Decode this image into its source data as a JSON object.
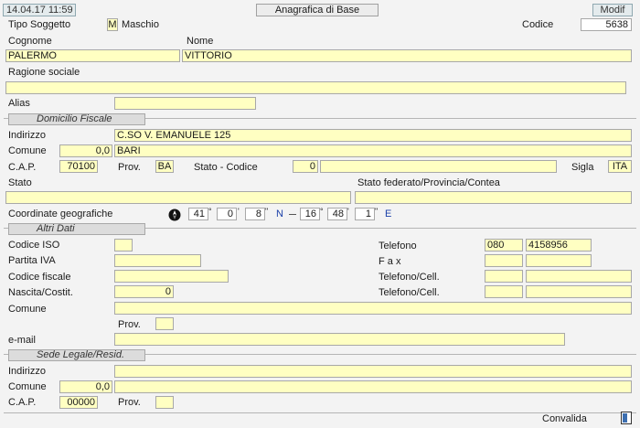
{
  "header": {
    "timestamp": "14.04.17 11:59",
    "title": "Anagrafica di Base",
    "mode": "Modif"
  },
  "subject": {
    "tipo_label": "Tipo Soggetto",
    "tipo_value": "M",
    "tipo_desc": "Maschio",
    "codice_label": "Codice",
    "codice_value": "5638",
    "cognome_label": "Cognome",
    "nome_label": "Nome",
    "cognome_value": "PALERMO",
    "nome_value": "VITTORIO",
    "ragione_label": "Ragione sociale",
    "ragione_value": "",
    "alias_label": "Alias",
    "alias_value": ""
  },
  "domicilio": {
    "section_title": "Domicilio Fiscale",
    "indirizzo_label": "Indirizzo",
    "indirizzo_value": "C.SO V. EMANUELE 125",
    "comune_label": "Comune",
    "comune_code": "0,0",
    "comune_value": "BARI",
    "cap_label": "C.A.P.",
    "cap_value": "70100",
    "prov_label": "Prov.",
    "prov_value": "BA",
    "stato_codice_label": "Stato - Codice",
    "stato_codice_value": "0",
    "stato_codice_desc": "",
    "sigla_label": "Sigla",
    "sigla_value": "ITA",
    "stato_label": "Stato",
    "stato_value": "",
    "stato_fed_label": "Stato federato/Provincia/Contea",
    "stato_fed_value": "",
    "coord_label": "Coordinate geografiche",
    "lat_deg": "41",
    "lat_min": "0",
    "lat_sec": "8",
    "lat_dir": "N",
    "lon_deg": "16",
    "lon_min": "48",
    "lon_sec": "1",
    "lon_dir": "E",
    "deg_symbol": "°",
    "min_symbol": "'",
    "sec_symbol": "\""
  },
  "altri": {
    "section_title": "Altri Dati",
    "codice_iso_label": "Codice ISO",
    "codice_iso_value": "",
    "partita_iva_label": "Partita IVA",
    "partita_iva_value": "",
    "codice_fiscale_label": "Codice fiscale",
    "codice_fiscale_value": "",
    "nascita_label": "Nascita/Costit.",
    "nascita_value": "0",
    "comune_label": "Comune",
    "comune_value": "",
    "prov_label": "Prov.",
    "prov_value": "",
    "email_label": "e-mail",
    "email_value": "",
    "telefono_label": "Telefono",
    "telefono_prefix": "080",
    "telefono_number": "4158956",
    "fax_label": "F a x",
    "fax_prefix": "",
    "fax_number": "",
    "cell1_label": "Telefono/Cell.",
    "cell1_prefix": "",
    "cell1_number": "",
    "cell2_label": "Telefono/Cell.",
    "cell2_prefix": "",
    "cell2_number": ""
  },
  "sede": {
    "section_title": "Sede Legale/Resid.",
    "indirizzo_label": "Indirizzo",
    "indirizzo_value": "",
    "comune_label": "Comune",
    "comune_code": "0,0",
    "comune_value": "",
    "cap_label": "C.A.P.",
    "cap_value": "00000",
    "prov_label": "Prov.",
    "prov_value": ""
  },
  "footer": {
    "convalida_label": "Convalida"
  },
  "colors": {
    "field_bg": "#ffffc2",
    "section_bg": "#dcdcdc",
    "coord_dir": "#1a3fa8"
  }
}
